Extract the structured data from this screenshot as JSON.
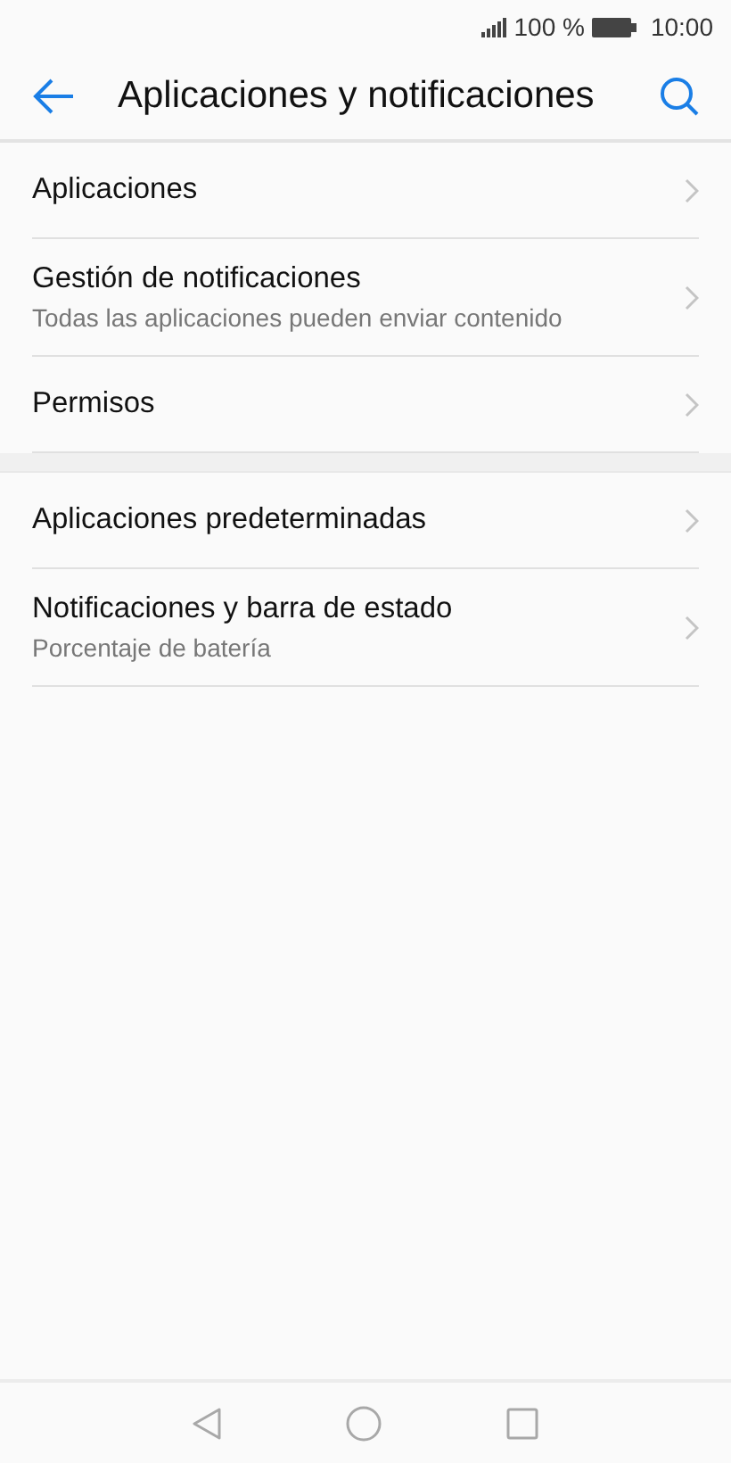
{
  "status_bar": {
    "battery_text": "100 %",
    "time": "10:00"
  },
  "header": {
    "title": "Aplicaciones y notificaciones"
  },
  "groups": [
    {
      "items": [
        {
          "title": "Aplicaciones"
        },
        {
          "title": "Gestión de notificaciones",
          "subtitle": "Todas las aplicaciones pueden enviar contenido"
        },
        {
          "title": "Permisos"
        }
      ]
    },
    {
      "items": [
        {
          "title": "Aplicaciones predeterminadas"
        },
        {
          "title": "Notificaciones y barra de estado",
          "subtitle": "Porcentaje de batería"
        }
      ]
    }
  ]
}
